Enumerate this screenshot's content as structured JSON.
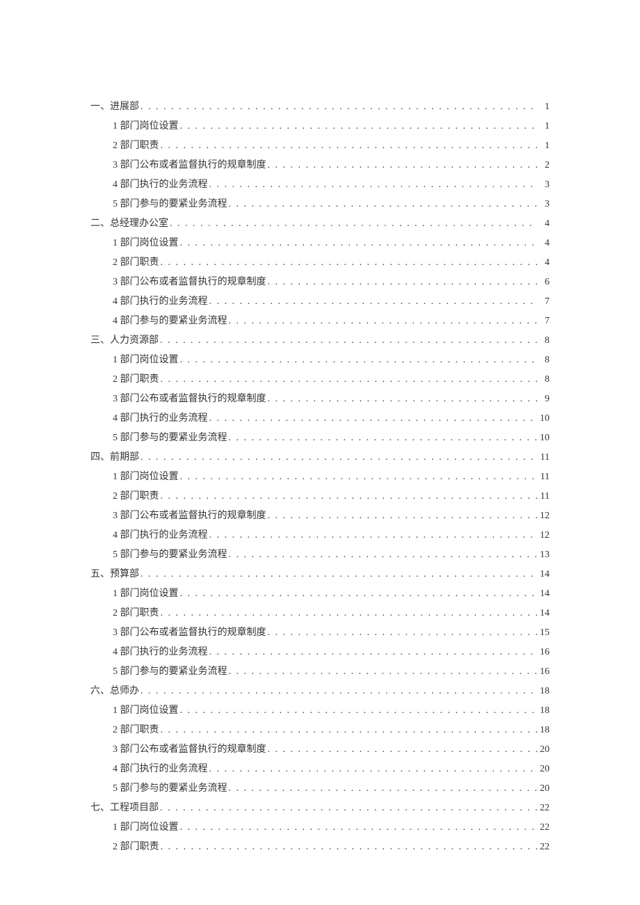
{
  "toc": [
    {
      "level": 1,
      "label": "一、进展部",
      "page": "1"
    },
    {
      "level": 2,
      "label": "1 部门岗位设置",
      "page": "1"
    },
    {
      "level": 2,
      "label": "2 部门职责",
      "page": "1"
    },
    {
      "level": 2,
      "label": "3 部门公布或者监督执行的规章制度",
      "page": "2"
    },
    {
      "level": 2,
      "label": "4 部门执行的业务流程",
      "page": "3"
    },
    {
      "level": 2,
      "label": "5 部门参与的要紧业务流程",
      "page": "3"
    },
    {
      "level": 1,
      "label": "二、总经理办公室",
      "page": "4"
    },
    {
      "level": 2,
      "label": "1 部门岗位设置",
      "page": "4"
    },
    {
      "level": 2,
      "label": "2 部门职责",
      "page": "4"
    },
    {
      "level": 2,
      "label": "3 部门公布或者监督执行的规章制度",
      "page": "6"
    },
    {
      "level": 2,
      "label": "4 部门执行的业务流程",
      "page": "7"
    },
    {
      "level": 2,
      "label": "4 部门参与的要紧业务流程",
      "page": "7"
    },
    {
      "level": 1,
      "label": "三、人力资源部",
      "page": "8"
    },
    {
      "level": 2,
      "label": "1 部门岗位设置",
      "page": "8"
    },
    {
      "level": 2,
      "label": "2 部门职责",
      "page": "8"
    },
    {
      "level": 2,
      "label": "3 部门公布或者监督执行的规章制度",
      "page": "9"
    },
    {
      "level": 2,
      "label": "4 部门执行的业务流程",
      "page": "10"
    },
    {
      "level": 2,
      "label": "5 部门参与的要紧业务流程",
      "page": "10"
    },
    {
      "level": 1,
      "label": "四、前期部",
      "page": "11"
    },
    {
      "level": 2,
      "label": "1 部门岗位设置",
      "page": "11"
    },
    {
      "level": 2,
      "label": "2 部门职责",
      "page": "11"
    },
    {
      "level": 2,
      "label": "3 部门公布或者监督执行的规章制度",
      "page": "12"
    },
    {
      "level": 2,
      "label": "4 部门执行的业务流程",
      "page": "12"
    },
    {
      "level": 2,
      "label": "5 部门参与的要紧业务流程",
      "page": "13"
    },
    {
      "level": 1,
      "label": "五、预算部",
      "page": "14"
    },
    {
      "level": 2,
      "label": "1 部门岗位设置",
      "page": "14"
    },
    {
      "level": 2,
      "label": "2 部门职责",
      "page": "14"
    },
    {
      "level": 2,
      "label": "3 部门公布或者监督执行的规章制度",
      "page": "15"
    },
    {
      "level": 2,
      "label": "4 部门执行的业务流程",
      "page": "16"
    },
    {
      "level": 2,
      "label": "5 部门参与的要紧业务流程",
      "page": "16"
    },
    {
      "level": 1,
      "label": "六、总师办",
      "page": "18"
    },
    {
      "level": 2,
      "label": "1 部门岗位设置",
      "page": "18"
    },
    {
      "level": 2,
      "label": "2 部门职责",
      "page": "18"
    },
    {
      "level": 2,
      "label": "3 部门公布或者监督执行的规章制度",
      "page": "20"
    },
    {
      "level": 2,
      "label": "4 部门执行的业务流程",
      "page": "20"
    },
    {
      "level": 2,
      "label": "5 部门参与的要紧业务流程",
      "page": "20"
    },
    {
      "level": 1,
      "label": "七、工程项目部",
      "page": "22"
    },
    {
      "level": 2,
      "label": "1 部门岗位设置",
      "page": "22"
    },
    {
      "level": 2,
      "label": "2 部门职责",
      "page": "22"
    }
  ]
}
